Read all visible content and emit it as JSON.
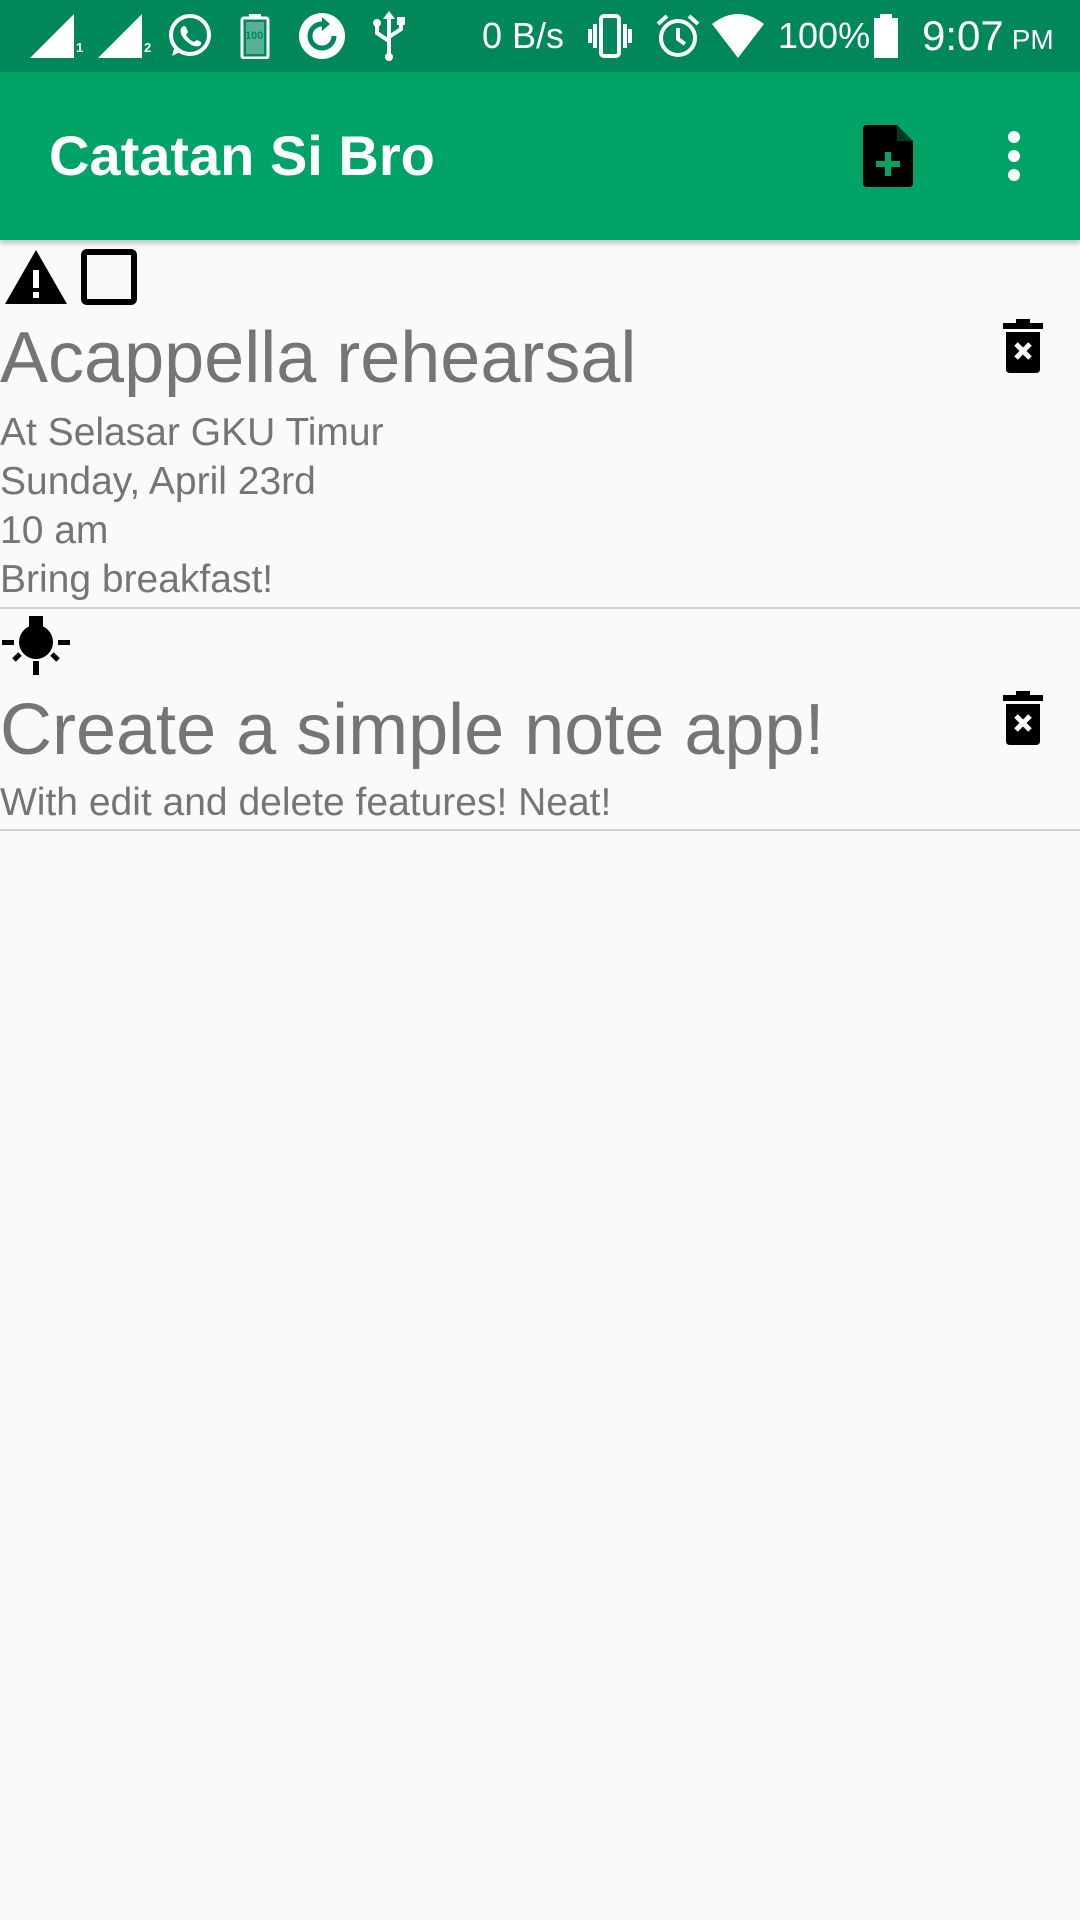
{
  "status_bar": {
    "sim1_label": "1",
    "sim2_label": "2",
    "battery_icon_text": "100",
    "network_speed": "0 B/s",
    "battery_percent": "100%",
    "time": "9:07",
    "am_pm": "PM",
    "icons": [
      "signal-sim1-icon",
      "signal-sim2-icon",
      "whatsapp-icon",
      "battery-saver-icon",
      "sync-icon",
      "usb-icon",
      "vibrate-icon",
      "alarm-icon",
      "wifi-icon",
      "battery-icon"
    ]
  },
  "app_bar": {
    "title": "Catatan Si Bro",
    "actions": [
      "add-note-icon",
      "more-vert-icon"
    ],
    "color": "#00a366",
    "status_color": "#00875a"
  },
  "notes": [
    {
      "icons": [
        "warning-icon",
        "checkbox-icon"
      ],
      "title": "Acappella rehearsal",
      "body": "At Selasar GKU Timur\nSunday, April 23rd\n10 am\nBring breakfast!",
      "delete_icon": "delete-forever-icon"
    },
    {
      "icons": [
        "lightbulb-icon"
      ],
      "title": "Create a simple note app!",
      "body": "With edit and delete features! Neat!",
      "delete_icon": "delete-forever-icon"
    }
  ],
  "colors": {
    "text_gray": "#757575",
    "background": "#fafafa",
    "divider": "#d0d0d0"
  }
}
